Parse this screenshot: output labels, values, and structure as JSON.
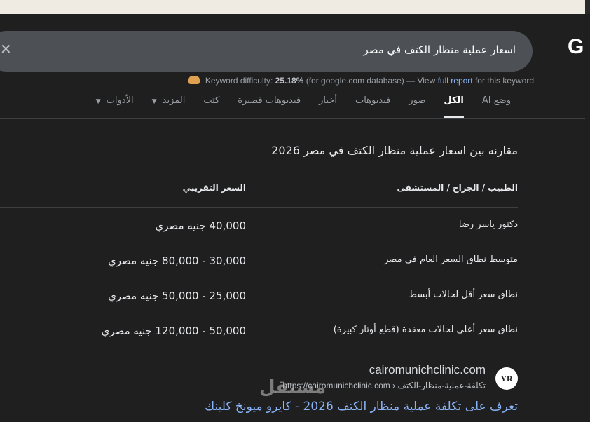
{
  "search": {
    "query": "اسعار عملية منظار الكتف في مصر",
    "logo": "G"
  },
  "keyword_difficulty": {
    "label": "Keyword difficulty:",
    "percent": "25.18%",
    "db": "(for google.com database) — View",
    "link": "full report",
    "suffix": "for this keyword"
  },
  "tabs": [
    {
      "label": "وضع AI",
      "active": false
    },
    {
      "label": "الكل",
      "active": true
    },
    {
      "label": "صور",
      "active": false
    },
    {
      "label": "فيديوهات",
      "active": false
    },
    {
      "label": "أخبار",
      "active": false
    },
    {
      "label": "فيديوهات قصيرة",
      "active": false
    },
    {
      "label": "كتب",
      "active": false
    },
    {
      "label": "المزيد",
      "active": false
    },
    {
      "label": "الأدوات",
      "active": false
    }
  ],
  "comparison": {
    "heading": "مقارنه بين اسعار عملية منظار الكتف في مصر 2026",
    "headers": [
      "الطبيب / الجراح / المستشفى",
      "السعر التقريبي"
    ],
    "rows": [
      [
        "دكتور ياسر رضا",
        "40,000 جنيه مصري"
      ],
      [
        "متوسط نطاق السعر العام في مصر",
        "30,000 - 80,000 جنيه مصري"
      ],
      [
        "نطاق سعر أقل لحالات أبسط",
        "25,000 - 50,000 جنيه مصري"
      ],
      [
        "نطاق سعر أعلى لحالات معقدة (قطع أوتار كبيرة)",
        "50,000 - 120,000 جنيه مصري"
      ]
    ]
  },
  "result": {
    "site_name": "cairomunichclinic.com",
    "url": "https://cairomunichclinic.com › تكلفة-عملية-منظار-الكتف",
    "favicon_text": "YR",
    "title": "تعرف على تكلفة عملية منظار الكتف 2026 - كايرو ميونخ كلينك"
  },
  "watermark": "مستقل"
}
